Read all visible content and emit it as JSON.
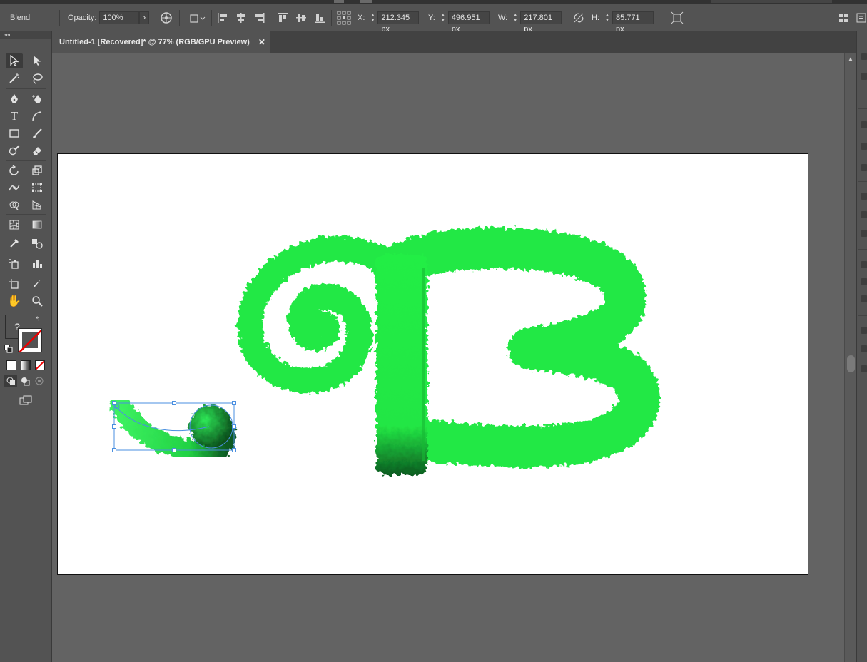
{
  "control_bar": {
    "selection_type": "Blend",
    "opacity_label": "Opacity:",
    "opacity_value": "100%",
    "x_label": "X:",
    "x_value": "212.345 px",
    "y_label": "Y:",
    "y_value": "496.951 px",
    "w_label": "W:",
    "w_value": "217.801 px",
    "h_label": "H:",
    "h_value": "85.771 px"
  },
  "document_tab": {
    "title": "Untitled-1 [Recovered]* @ 77% (RGB/GPU Preview)",
    "close": "✕"
  },
  "toolbar": {
    "fill_stroke_unknown": "?"
  },
  "colors": {
    "ui_bg": "#535353",
    "canvas_bg": "#636363",
    "artboard": "#ffffff",
    "grass_light": "#22ee44",
    "grass_dark": "#0a5a1e",
    "selection": "#4a8fe0"
  }
}
